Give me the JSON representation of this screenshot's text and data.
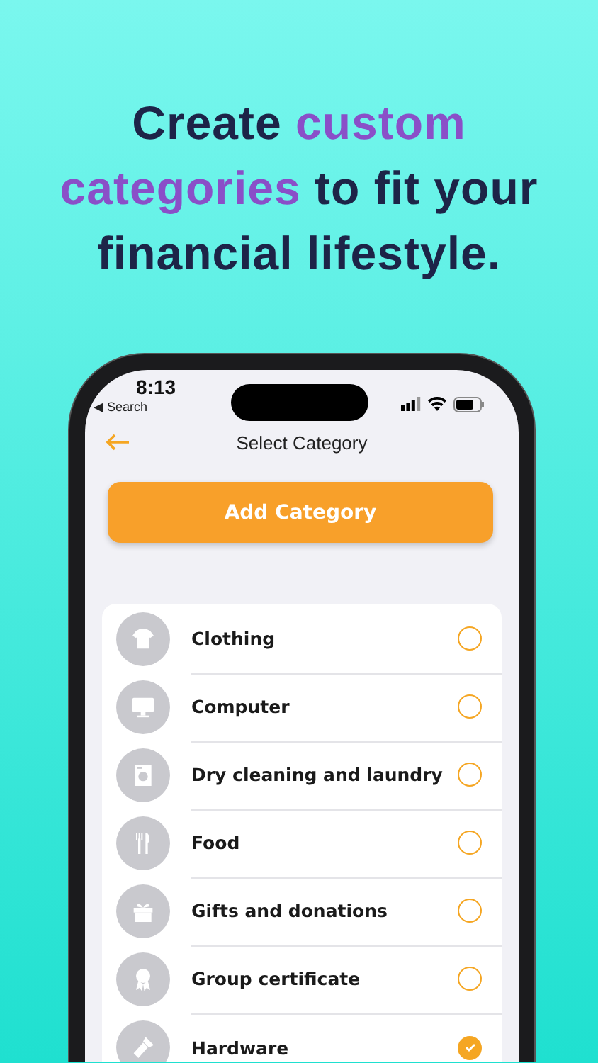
{
  "headline": [
    {
      "text": "Create",
      "accent": false
    },
    {
      "text": "custom",
      "accent": true
    },
    {
      "text": "categories",
      "accent": true
    },
    {
      "text": "to fit your financial lifestyle.",
      "accent": false
    }
  ],
  "status_bar": {
    "time": "8:13",
    "back_link": "◀ Search"
  },
  "nav": {
    "title": "Select Category"
  },
  "add_button": "Add Category",
  "categories": [
    {
      "name": "Clothing",
      "selected": false
    },
    {
      "name": "Computer",
      "selected": false
    },
    {
      "name": "Dry cleaning and laundry",
      "selected": false
    },
    {
      "name": "Food",
      "selected": false
    },
    {
      "name": "Gifts and donations",
      "selected": false
    },
    {
      "name": "Group certificate",
      "selected": false
    },
    {
      "name": "Hardware",
      "selected": true
    }
  ]
}
